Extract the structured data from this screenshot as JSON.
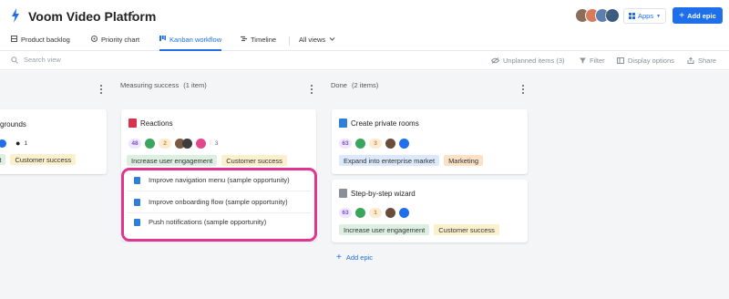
{
  "app": {
    "title": "Voom Video Platform",
    "apps_label": "Apps",
    "add_epic_label": "Add epic",
    "avatars_more": "9+"
  },
  "tabs": [
    {
      "label": "Product backlog",
      "icon": "backlog-icon"
    },
    {
      "label": "Priority chart",
      "icon": "target-icon"
    },
    {
      "label": "Kanban workflow",
      "icon": "kanban-icon",
      "active": true
    },
    {
      "label": "Timeline",
      "icon": "timeline-icon"
    },
    {
      "label": "All views",
      "icon": "chevron-down-icon"
    }
  ],
  "toolbar": {
    "search_placeholder": "Search view",
    "unplanned": "Unplanned items (3)",
    "filter": "Filter",
    "display_options": "Display options",
    "share": "Share"
  },
  "columns": [
    {
      "title": "Measuring success",
      "count": "(1 item)",
      "cards": [
        {
          "title": "Reactions",
          "score": "48",
          "effort": "2",
          "children": "3",
          "tags": [
            "Increase user engagement",
            "Customer success"
          ],
          "features": [
            "Improve navigation menu (sample opportunity)",
            "Improve onboarding flow (sample opportunity)",
            "Push notifications (sample opportunity)"
          ]
        }
      ]
    },
    {
      "title": "Done",
      "count": "(2 items)",
      "cards": [
        {
          "title": "Create private rooms",
          "score": "63",
          "effort": "3",
          "tags": [
            "Expand into enterprise market",
            "Marketing"
          ]
        },
        {
          "title": "Step-by-step wizard",
          "score": "63",
          "effort": "1",
          "tags": [
            "Increase user engagement",
            "Customer success"
          ]
        }
      ],
      "add_epic": "Add epic"
    }
  ],
  "partial_card": {
    "title": "grounds",
    "comments": "1",
    "tags": [
      "ent",
      "Customer success"
    ]
  },
  "colors": {
    "accent": "#1f6feb",
    "highlight": "#e0368f",
    "tag_green": "#dcefe1",
    "tag_yellow": "#fbf0cc",
    "tag_blue": "#dbe9fb",
    "tag_orange": "#fbe2c6"
  }
}
